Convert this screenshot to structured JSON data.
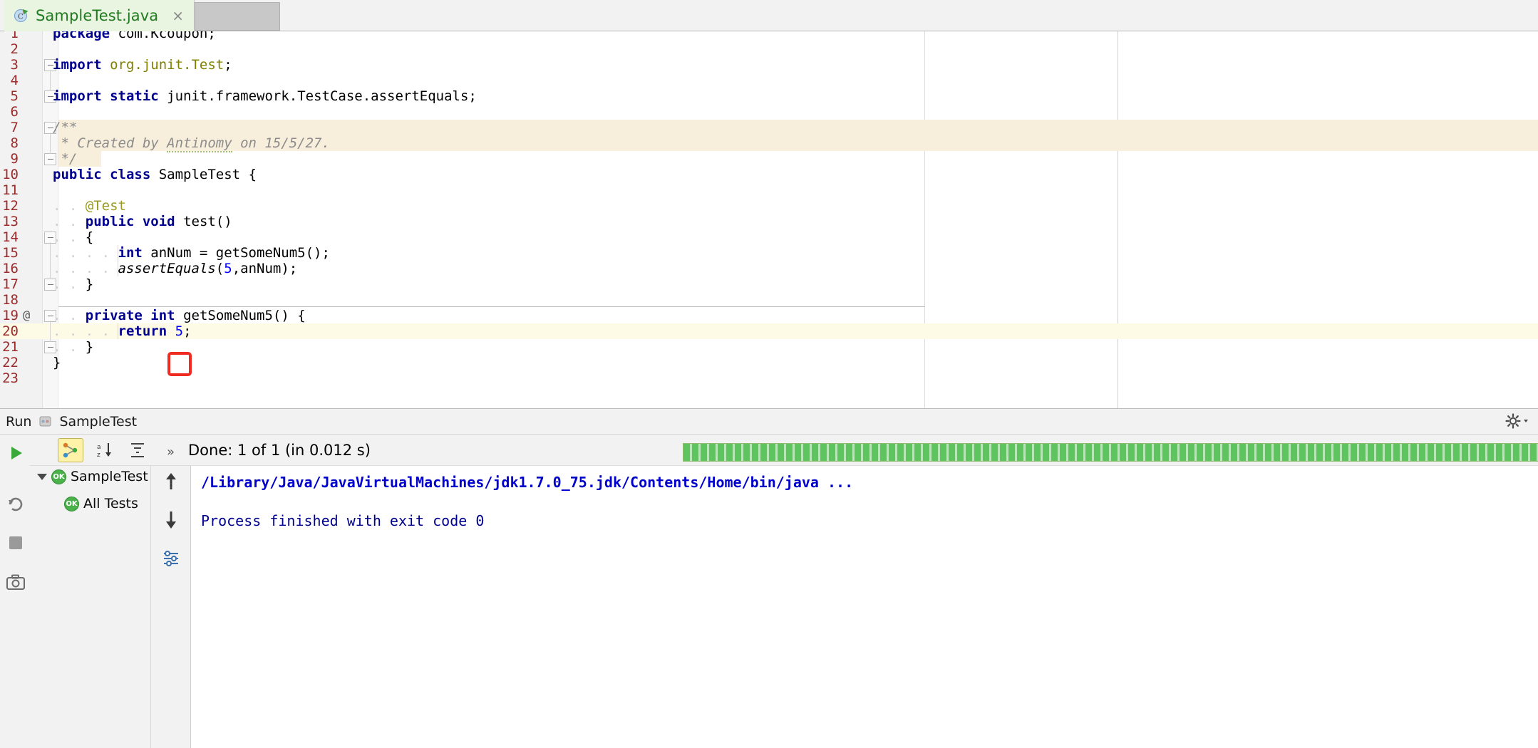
{
  "window": {
    "app": "IntelliJ IDEA",
    "accent_green": "#1f7a1f",
    "highlight_yellow": "#f7eedb",
    "annotation_red": "#ef2b22"
  },
  "tabbar": {
    "tabs": [
      {
        "label": "SampleTest.java",
        "icon": "java-class-run-icon",
        "close": "×",
        "active": true
      }
    ]
  },
  "editor": {
    "lines": [
      {
        "n": "1",
        "at": "",
        "fold": "none",
        "highlight": "none",
        "tokens": [
          {
            "t": "package",
            "c": "kw"
          },
          {
            "t": " com.Kcoupon;",
            "c": "plain"
          }
        ]
      },
      {
        "n": "2",
        "at": "",
        "fold": "none",
        "highlight": "none",
        "tokens": []
      },
      {
        "n": "3",
        "at": "",
        "fold": "minus",
        "highlight": "none",
        "tokens": [
          {
            "t": "import",
            "c": "kw"
          },
          {
            "t": " ",
            "c": "plain"
          },
          {
            "t": "org.junit.Test",
            "c": "str"
          },
          {
            "t": ";",
            "c": "plain"
          }
        ]
      },
      {
        "n": "4",
        "at": "",
        "fold": "none",
        "highlight": "none",
        "tokens": []
      },
      {
        "n": "5",
        "at": "",
        "fold": "top",
        "highlight": "none",
        "tokens": [
          {
            "t": "import",
            "c": "kw"
          },
          {
            "t": " ",
            "c": "plain"
          },
          {
            "t": "static",
            "c": "kw"
          },
          {
            "t": " junit.framework.TestCase.assertEquals;",
            "c": "plain"
          }
        ]
      },
      {
        "n": "6",
        "at": "",
        "fold": "none",
        "highlight": "none",
        "tokens": []
      },
      {
        "n": "7",
        "at": "",
        "fold": "minus",
        "highlight": "comment",
        "tokens": [
          {
            "t": "/**",
            "c": "cmt"
          }
        ]
      },
      {
        "n": "8",
        "at": "",
        "fold": "none",
        "highlight": "comment",
        "tokens": [
          {
            "t": " * Created by ",
            "c": "cmt"
          },
          {
            "t": "Antinomy",
            "c": "cmt spell"
          },
          {
            "t": " on 15/5/27.",
            "c": "cmt"
          }
        ]
      },
      {
        "n": "9",
        "at": "",
        "fold": "bottom",
        "highlight": "comment-short",
        "tokens": [
          {
            "t": " */",
            "c": "cmt"
          }
        ]
      },
      {
        "n": "10",
        "at": "",
        "fold": "none",
        "highlight": "none",
        "tokens": [
          {
            "t": "public",
            "c": "kw"
          },
          {
            "t": " ",
            "c": "plain"
          },
          {
            "t": "class",
            "c": "kw"
          },
          {
            "t": " SampleTest {",
            "c": "plain"
          }
        ]
      },
      {
        "n": "11",
        "at": "",
        "fold": "none",
        "highlight": "none",
        "tokens": []
      },
      {
        "n": "12",
        "at": "",
        "fold": "none",
        "highlight": "none",
        "tokens": [
          {
            "t": "    ",
            "c": "plain"
          },
          {
            "t": "@Test",
            "c": "anno"
          }
        ]
      },
      {
        "n": "13",
        "at": "",
        "fold": "none",
        "highlight": "none",
        "tokens": [
          {
            "t": "    ",
            "c": "plain"
          },
          {
            "t": "public",
            "c": "kw"
          },
          {
            "t": " ",
            "c": "plain"
          },
          {
            "t": "void",
            "c": "kw"
          },
          {
            "t": " test()",
            "c": "plain"
          }
        ]
      },
      {
        "n": "14",
        "at": "",
        "fold": "minus",
        "highlight": "none",
        "tokens": [
          {
            "t": "    {",
            "c": "plain"
          }
        ]
      },
      {
        "n": "15",
        "at": "",
        "fold": "none",
        "highlight": "none",
        "tokens": [
          {
            "t": "        ",
            "c": "plain"
          },
          {
            "t": "int",
            "c": "kw"
          },
          {
            "t": " anNum = getSomeNum5();",
            "c": "plain"
          }
        ]
      },
      {
        "n": "16",
        "at": "",
        "fold": "none",
        "highlight": "none",
        "tokens": [
          {
            "t": "        ",
            "c": "plain"
          },
          {
            "t": "assertEquals",
            "c": "ital"
          },
          {
            "t": "(",
            "c": "plain"
          },
          {
            "t": "5",
            "c": "num"
          },
          {
            "t": ",anNum);",
            "c": "plain"
          }
        ]
      },
      {
        "n": "17",
        "at": "",
        "fold": "bottom",
        "highlight": "none",
        "tokens": [
          {
            "t": "    }",
            "c": "plain"
          }
        ]
      },
      {
        "n": "18",
        "at": "",
        "fold": "none",
        "highlight": "none",
        "tokens": []
      },
      {
        "n": "19",
        "at": "@",
        "fold": "minus",
        "highlight": "none",
        "tokens": [
          {
            "t": "    ",
            "c": "plain"
          },
          {
            "t": "private",
            "c": "kw"
          },
          {
            "t": " ",
            "c": "plain"
          },
          {
            "t": "int",
            "c": "kw"
          },
          {
            "t": " getSomeNum5() {",
            "c": "plain"
          }
        ]
      },
      {
        "n": "20",
        "at": "",
        "fold": "none",
        "highlight": "caret",
        "tokens": [
          {
            "t": "        ",
            "c": "plain"
          },
          {
            "t": "return",
            "c": "kw"
          },
          {
            "t": " ",
            "c": "plain"
          },
          {
            "t": "5",
            "c": "num"
          },
          {
            "t": ";",
            "c": "plain"
          }
        ]
      },
      {
        "n": "21",
        "at": "",
        "fold": "bottom",
        "highlight": "none",
        "tokens": [
          {
            "t": "    }",
            "c": "plain"
          }
        ]
      },
      {
        "n": "22",
        "at": "",
        "fold": "none",
        "highlight": "none",
        "tokens": [
          {
            "t": "}",
            "c": "plain"
          }
        ]
      },
      {
        "n": "23",
        "at": "",
        "fold": "none",
        "highlight": "none",
        "tokens": []
      }
    ],
    "annotation": {
      "kind": "red-rect-highlight",
      "target": "return-value-5"
    }
  },
  "run_panel": {
    "header": {
      "title": "Run",
      "config_name": "SampleTest",
      "config_icon": "junit-icon",
      "settings_icon": "gear-icon",
      "settings_dropdown_icon": "chevron-down-icon"
    },
    "toolbar_left": [
      {
        "name": "rerun-button",
        "icon": "play-icon"
      },
      {
        "name": "rerun-failed-button",
        "icon": "rerun-failed-icon"
      },
      {
        "name": "stop-button",
        "icon": "stop-square-icon"
      },
      {
        "name": "export-button",
        "icon": "camera-icon"
      }
    ],
    "toolbar_top": [
      {
        "name": "run-button",
        "icon": "green-play-icon"
      },
      {
        "name": "toggle-tree-button",
        "icon": "test-tree-icon",
        "selected": true
      },
      {
        "name": "sort-alphabetically-button",
        "icon": "sort-az-icon"
      },
      {
        "name": "collapse-all-button",
        "icon": "collapse-all-icon"
      },
      {
        "name": "expand-menu-button",
        "icon": "double-chevron-right-icon"
      }
    ],
    "status_text": "Done: 1 of 1 (in 0.012 s)",
    "progress": {
      "percent": 100,
      "color": "#5ec45e"
    },
    "tree": [
      {
        "label": "SampleTest (",
        "indent": 0,
        "expander": "triangle-down",
        "badge": "ok",
        "depth": 0
      },
      {
        "label": "All Tests",
        "indent": 1,
        "expander": "none",
        "badge": "ok",
        "depth": 1
      }
    ],
    "tree_toolbar": [
      {
        "name": "prev-failed-button",
        "icon": "arrow-up-icon"
      },
      {
        "name": "next-failed-button",
        "icon": "arrow-down-icon"
      },
      {
        "name": "test-settings-button",
        "icon": "settings-list-icon"
      }
    ],
    "console": [
      {
        "text": "/Library/Java/JavaVirtualMachines/jdk1.7.0_75.jdk/Contents/Home/bin/java ...",
        "style": "c-blue"
      },
      {
        "text": "",
        "style": "c-dark"
      },
      {
        "text": "Process finished with exit code 0",
        "style": "c-dark"
      }
    ]
  }
}
